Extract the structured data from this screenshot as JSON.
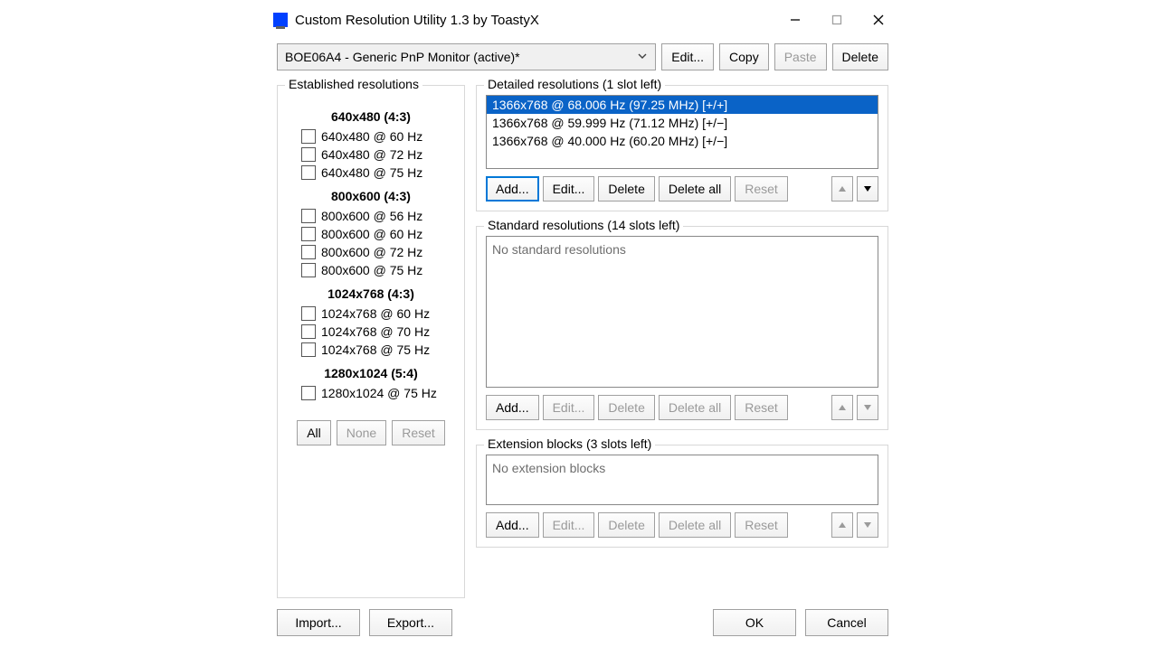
{
  "window": {
    "title": "Custom Resolution Utility 1.3 by ToastyX"
  },
  "top": {
    "monitor": "BOE06A4 - Generic PnP Monitor (active)*",
    "edit": "Edit...",
    "copy": "Copy",
    "paste": "Paste",
    "delete": "Delete"
  },
  "established": {
    "label": "Established resolutions",
    "groups": [
      {
        "header": "640x480 (4:3)",
        "items": [
          "640x480 @ 60 Hz",
          "640x480 @ 72 Hz",
          "640x480 @ 75 Hz"
        ]
      },
      {
        "header": "800x600 (4:3)",
        "items": [
          "800x600 @ 56 Hz",
          "800x600 @ 60 Hz",
          "800x600 @ 72 Hz",
          "800x600 @ 75 Hz"
        ]
      },
      {
        "header": "1024x768 (4:3)",
        "items": [
          "1024x768 @ 60 Hz",
          "1024x768 @ 70 Hz",
          "1024x768 @ 75 Hz"
        ]
      },
      {
        "header": "1280x1024 (5:4)",
        "items": [
          "1280x1024 @ 75 Hz"
        ]
      }
    ],
    "all": "All",
    "none": "None",
    "reset": "Reset"
  },
  "detailed": {
    "label": "Detailed resolutions (1 slot left)",
    "rows": [
      "1366x768 @ 68.006 Hz (97.25 MHz) [+/+]",
      "1366x768 @ 59.999 Hz (71.12 MHz) [+/−]",
      "1366x768 @ 40.000 Hz (60.20 MHz) [+/−]"
    ],
    "add": "Add...",
    "edit": "Edit...",
    "delete": "Delete",
    "delete_all": "Delete all",
    "reset": "Reset"
  },
  "standard": {
    "label": "Standard resolutions (14 slots left)",
    "placeholder": "No standard resolutions",
    "add": "Add...",
    "edit": "Edit...",
    "delete": "Delete",
    "delete_all": "Delete all",
    "reset": "Reset"
  },
  "extension": {
    "label": "Extension blocks (3 slots left)",
    "placeholder": "No extension blocks",
    "add": "Add...",
    "edit": "Edit...",
    "delete": "Delete",
    "delete_all": "Delete all",
    "reset": "Reset"
  },
  "footer": {
    "import": "Import...",
    "export": "Export...",
    "ok": "OK",
    "cancel": "Cancel"
  }
}
